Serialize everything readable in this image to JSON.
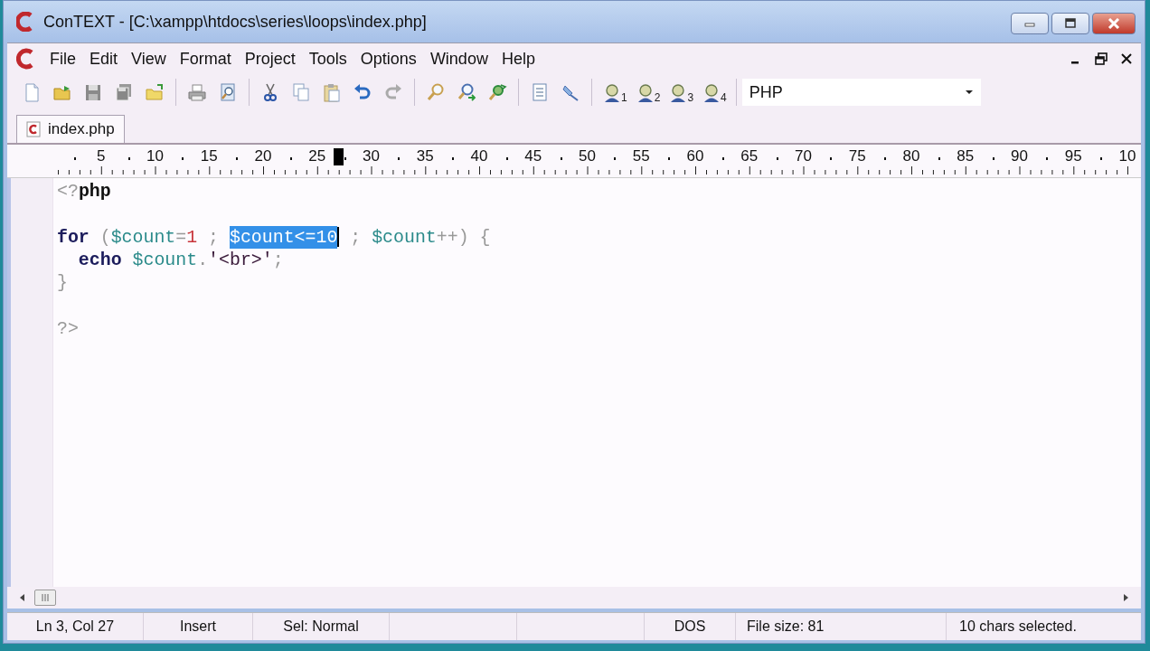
{
  "window": {
    "title": "ConTEXT - [C:\\xampp\\htdocs\\series\\loops\\index.php]"
  },
  "menu": [
    "File",
    "Edit",
    "View",
    "Format",
    "Project",
    "Tools",
    "Options",
    "Window",
    "Help"
  ],
  "toolbar": {
    "user_buttons": [
      "1",
      "2",
      "3",
      "4"
    ],
    "language": "PHP"
  },
  "tabs": [
    {
      "label": "index.php",
      "selected": true
    }
  ],
  "ruler": {
    "labels": [
      "5",
      "10",
      "15",
      "20",
      "25",
      "30",
      "35",
      "40",
      "45",
      "50",
      "55",
      "60",
      "65",
      "70",
      "75",
      "80",
      "85",
      "90",
      "95",
      "10"
    ]
  },
  "editor": {
    "lines": [
      {
        "kind": "code",
        "tokens": [
          {
            "text": "<?",
            "kind": "punct"
          },
          {
            "text": "php",
            "kind": "tag"
          }
        ]
      },
      {
        "kind": "blank"
      },
      {
        "kind": "code",
        "tokens": [
          {
            "text": "for",
            "kind": "keyword"
          },
          {
            "text": " (",
            "kind": "punct"
          },
          {
            "text": "$count",
            "kind": "var"
          },
          {
            "text": "=",
            "kind": "punct"
          },
          {
            "text": "1",
            "kind": "number"
          },
          {
            "text": " ; ",
            "kind": "punct"
          },
          {
            "text": "$count<=10",
            "kind": "var",
            "selected": true,
            "caret": true
          },
          {
            "text": " ; ",
            "kind": "punct"
          },
          {
            "text": "$count",
            "kind": "var"
          },
          {
            "text": "++) {",
            "kind": "punct"
          }
        ]
      },
      {
        "kind": "code",
        "indented": true,
        "tokens": [
          {
            "text": "echo",
            "kind": "keyword"
          },
          {
            "text": "$count",
            "kind": "var",
            "space_before": true
          },
          {
            "text": ".",
            "kind": "punct"
          },
          {
            "text": "'<br>'",
            "kind": "string"
          },
          {
            "text": ";",
            "kind": "punct"
          }
        ]
      },
      {
        "kind": "code",
        "tokens": [
          {
            "text": "}",
            "kind": "punct"
          }
        ]
      },
      {
        "kind": "blank"
      },
      {
        "kind": "code",
        "tokens": [
          {
            "text": "?>",
            "kind": "punct"
          }
        ]
      }
    ]
  },
  "status_bar": [
    {
      "kind": "text",
      "text": "Ln 3, Col 27"
    },
    {
      "kind": "text",
      "text": "Insert"
    },
    {
      "kind": "text",
      "text": "Sel: Normal"
    },
    {
      "kind": "empty"
    },
    {
      "kind": "empty"
    },
    {
      "kind": "text",
      "text": "DOS"
    },
    {
      "kind": "text",
      "text": "File size: 81"
    },
    {
      "kind": "text",
      "text": "10 chars selected."
    }
  ]
}
